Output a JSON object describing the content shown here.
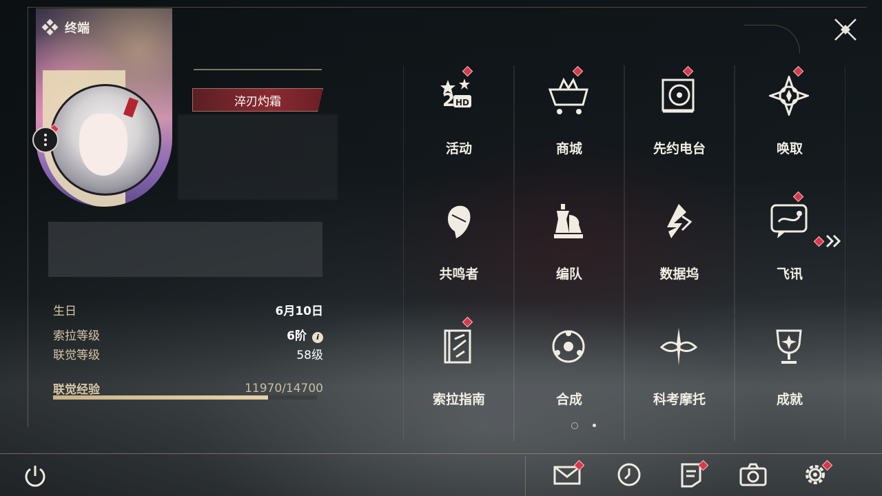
{
  "header": {
    "title": "终端"
  },
  "profile": {
    "title_tag": "淬刃灼霜",
    "info": [
      {
        "label": "生日",
        "value": "6月10日"
      },
      {
        "label": "索拉等级",
        "value": "6阶"
      },
      {
        "label": "联觉等级",
        "value": "58级"
      }
    ],
    "exp": {
      "label": "联觉经验",
      "value": "11970/14700",
      "progress": 0.814
    },
    "info_icon_text": "i"
  },
  "menu": [
    {
      "label": "活动",
      "icon": "activity-2hd-icon",
      "badge": true
    },
    {
      "label": "商城",
      "icon": "shop-cart-icon",
      "badge": true
    },
    {
      "label": "先约电台",
      "icon": "radio-vinyl-icon",
      "badge": true
    },
    {
      "label": "唤取",
      "icon": "summon-compass-icon",
      "badge": true
    },
    {
      "label": "共鸣者",
      "icon": "resonator-icon",
      "badge": false
    },
    {
      "label": "编队",
      "icon": "team-chess-icon",
      "badge": false
    },
    {
      "label": "数据坞",
      "icon": "data-dock-icon",
      "badge": false
    },
    {
      "label": "飞讯",
      "icon": "message-chat-icon",
      "badge": true
    },
    {
      "label": "索拉指南",
      "icon": "guide-book-icon",
      "badge": true
    },
    {
      "label": "合成",
      "icon": "synthesis-icon",
      "badge": false
    },
    {
      "label": "科考摩托",
      "icon": "motorcycle-icon",
      "badge": false
    },
    {
      "label": "成就",
      "icon": "trophy-icon",
      "badge": false
    }
  ],
  "pagination": {
    "current": 1,
    "total": 2
  },
  "bottom_bar": [
    "mail-icon",
    "clock-icon",
    "notes-icon",
    "camera-icon",
    "settings-gear-icon"
  ],
  "colors": {
    "accent": "#d8c39a",
    "badge": "#d8394a",
    "title_tag": "#8a2a32"
  }
}
